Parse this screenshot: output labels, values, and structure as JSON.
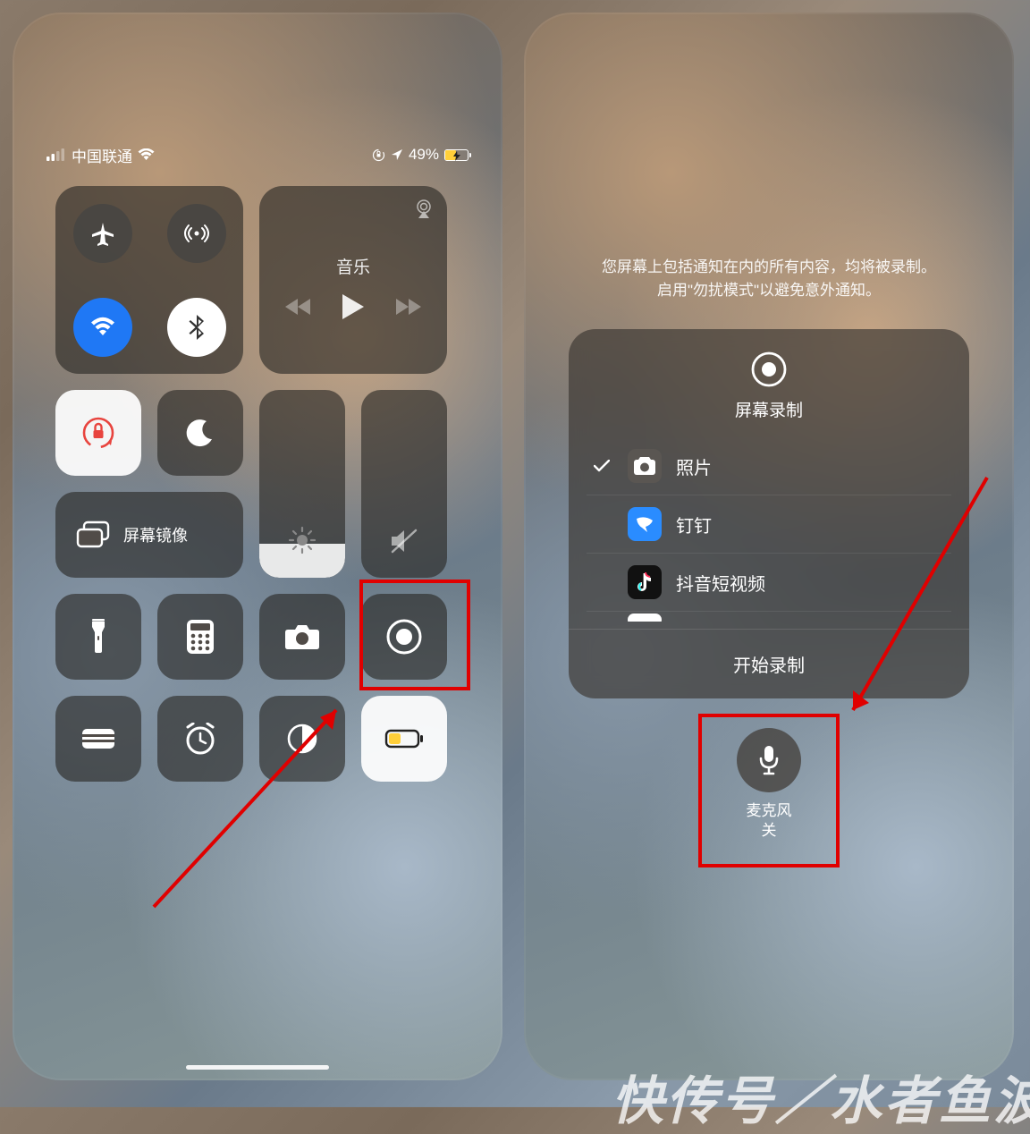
{
  "status": {
    "carrier": "中国联通",
    "battery_pct": "49%"
  },
  "music": {
    "title": "音乐"
  },
  "mirror": {
    "label": "屏幕镜像"
  },
  "record_panel": {
    "hint_line1": "您屏幕上包括通知在内的所有内容，均将被录制。",
    "hint_line2": "启用\"勿扰模式\"以避免意外通知。",
    "title": "屏幕录制",
    "apps": [
      {
        "name": "照片",
        "selected": true,
        "icon": "photos"
      },
      {
        "name": "钉钉",
        "selected": false,
        "icon": "dingtalk"
      },
      {
        "name": "抖音短视频",
        "selected": false,
        "icon": "douyin"
      }
    ],
    "start_label": "开始录制"
  },
  "mic": {
    "label_line1": "麦克风",
    "label_line2": "关"
  },
  "watermark": "快传号／水者鱼波"
}
